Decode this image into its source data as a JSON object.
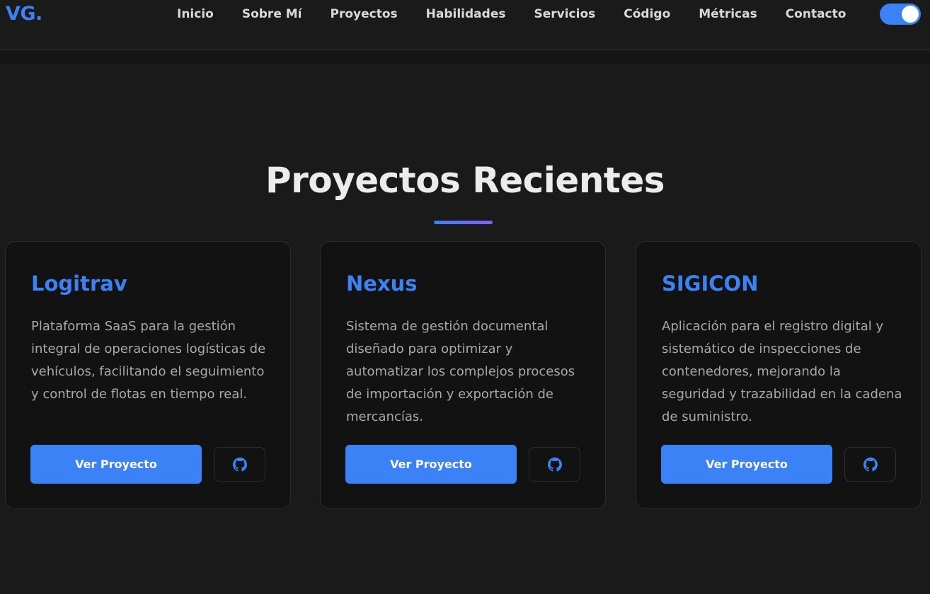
{
  "brand": {
    "logo": "VG.",
    "accent": "#3b82f6"
  },
  "nav": {
    "links": [
      "Inicio",
      "Sobre Mí",
      "Proyectos",
      "Habilidades",
      "Servicios",
      "Código",
      "Métricas",
      "Contacto"
    ],
    "theme_toggle_on": true
  },
  "section": {
    "title": "Proyectos Recientes"
  },
  "projects": [
    {
      "title": "Logitrav",
      "description": "Plataforma SaaS para la gestión integral de operaciones logísticas de vehículos, facilitando el seguimiento y control de flotas en tiempo real.",
      "button": "Ver Proyecto",
      "icon": "github-icon"
    },
    {
      "title": "Nexus",
      "description": "Sistema de gestión documental diseñado para optimizar y automatizar los complejos procesos de importación y exportación de mercancías.",
      "button": "Ver Proyecto",
      "icon": "github-icon"
    },
    {
      "title": "SIGICON",
      "description": "Aplicación para el registro digital y sistemático de inspecciones de contenedores, mejorando la seguridad y trazabilidad en la cadena de suministro.",
      "button": "Ver Proyecto",
      "icon": "github-icon"
    }
  ]
}
